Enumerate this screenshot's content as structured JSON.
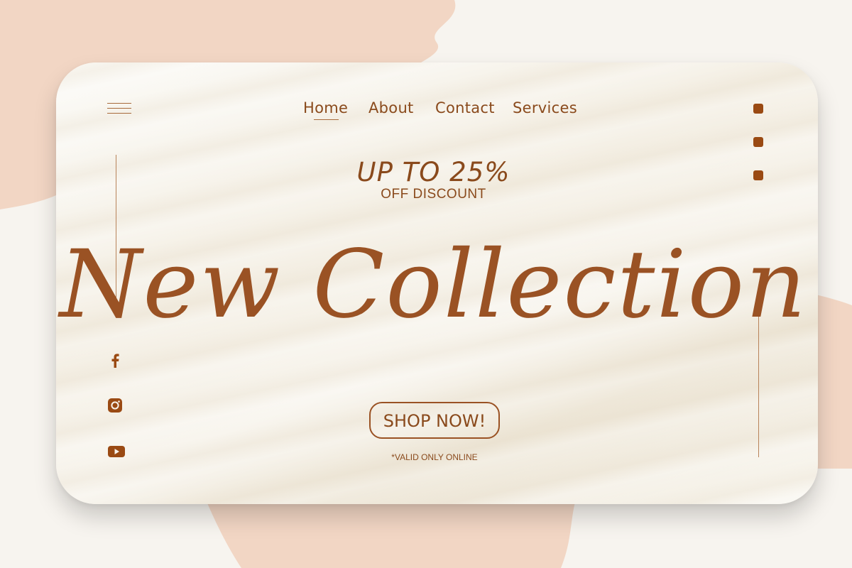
{
  "nav": {
    "items": [
      "Home",
      "About",
      "Contact",
      "Services"
    ]
  },
  "promo": {
    "title": "UP TO 25%",
    "subtitle": "OFF DISCOUNT"
  },
  "headline": "New Collection",
  "cta": {
    "label": "SHOP NOW!",
    "note": "*VALID ONLY ONLINE"
  },
  "icons": {
    "menu": "hamburger-menu-icon",
    "social": [
      "facebook-icon",
      "instagram-icon",
      "youtube-icon"
    ]
  },
  "colors": {
    "accent": "#9a4a13",
    "text": "#8a4a1c",
    "background": "#f7f4ef",
    "blob": "#f3d8c7"
  }
}
